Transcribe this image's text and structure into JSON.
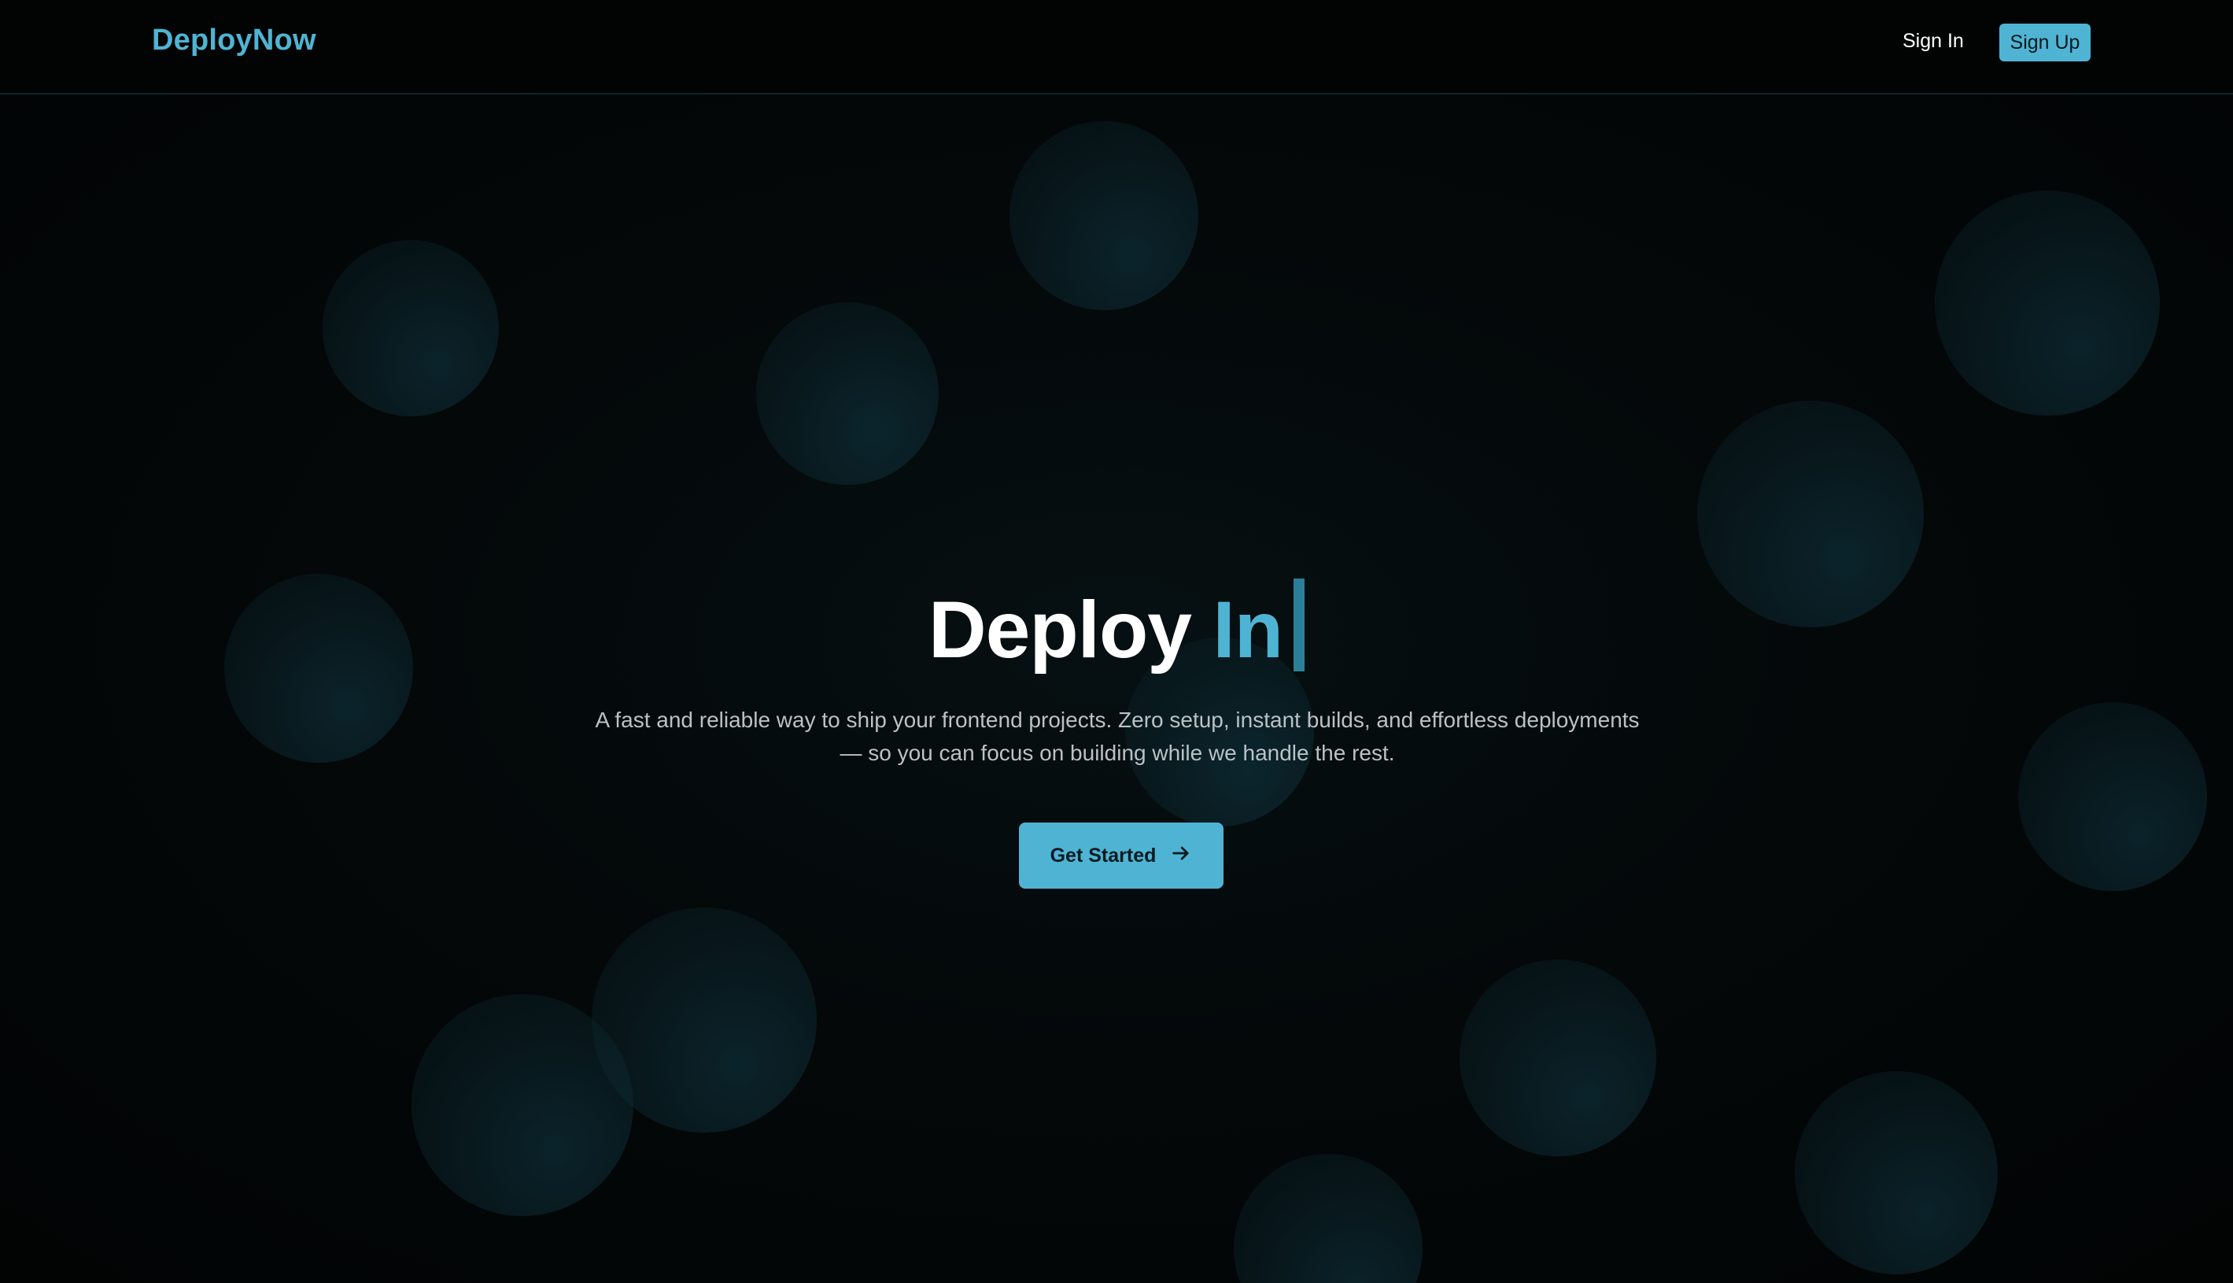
{
  "header": {
    "brand": "DeployNow",
    "sign_in": "Sign In",
    "sign_up": "Sign Up"
  },
  "hero": {
    "title_main": "Deploy",
    "title_accent": "In",
    "subtitle_line1": "A fast and reliable way to ship your frontend projects. Zero setup, instant builds, and effortless deployments",
    "subtitle_line2": "— so you can focus on building while we handle the rest.",
    "cta_label": "Get Started",
    "cta_icon": "arrow-right-icon"
  },
  "colors": {
    "accent": "#4fb4d3",
    "background": "#030607",
    "text": "#ffffff",
    "muted_text": "#b9c2c6"
  }
}
